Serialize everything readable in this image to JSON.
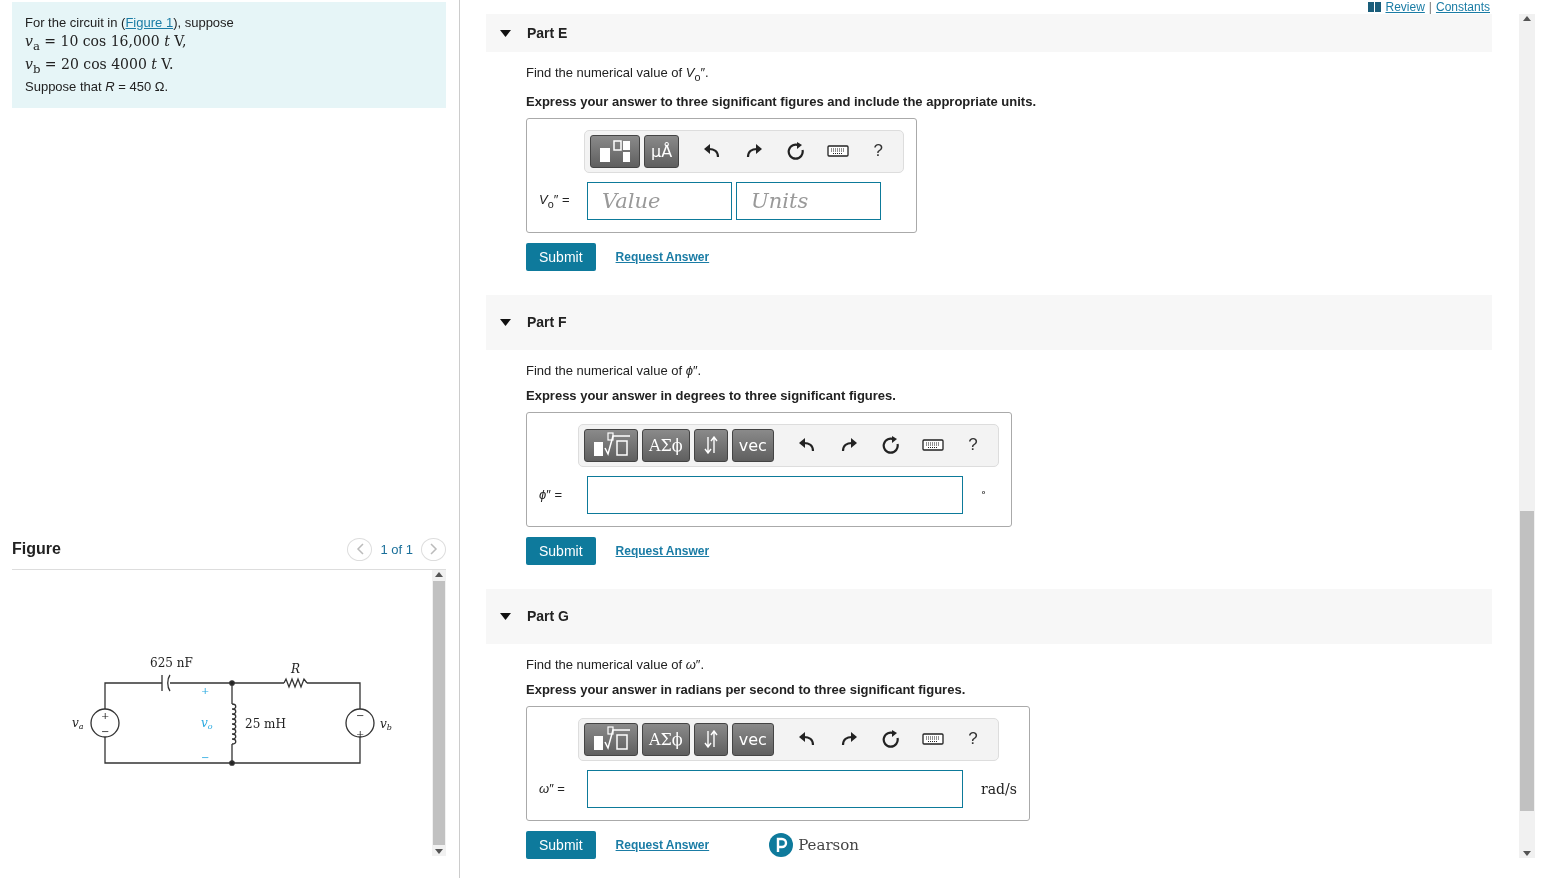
{
  "problem": {
    "intro": {
      "before": "For the circuit in (",
      "link": "Figure 1",
      "after": "), suppose"
    },
    "lines": [
      "*v*$_{a}$ = 10 cos 16,000 *t* V,",
      "*v*$_{b}$ = 20 cos 4000 *t* V."
    ],
    "closing": "Suppose that *R* = 450 Ω."
  },
  "figure": {
    "title": "Figure",
    "pager": "1 of 1",
    "capacitor": "625 nF",
    "resistor": "R",
    "inductor": "25 mH",
    "sources": [
      {
        "symbol": "v",
        "subscript": "a",
        "top": "+",
        "bottom": "−"
      },
      {
        "symbol": "v",
        "subscript": "b",
        "top": "−",
        "bottom": "+"
      }
    ],
    "output": {
      "symbol": "v",
      "subscript": "o",
      "plus": "+",
      "minus": "−"
    }
  },
  "links": {
    "review": "Review",
    "separator": "|",
    "constants": "Constants"
  },
  "parts": [
    {
      "title": "Part E",
      "expanded": true,
      "prompt": "Find the numerical value of *V*$_{o}$″.",
      "instruction": "Express your answer to three significant figures and include the appropriate units.",
      "variable": "*V*$_{o}$″ =",
      "toolbar": [
        {
          "kind": "grid"
        },
        {
          "kind": "label",
          "label": "μÅ"
        }
      ],
      "help": "?",
      "fields": [
        {
          "placeholder": "Value"
        },
        {
          "placeholder": "Units"
        }
      ],
      "submit": "Submit",
      "request": "Request Answer"
    },
    {
      "title": "Part F",
      "expanded": true,
      "prompt": "Find the numerical value of *ϕ*″.",
      "instruction": "Express your answer in degrees to three significant figures.",
      "variable": "*ϕ*″ =",
      "toolbar": [
        {
          "kind": "root"
        },
        {
          "kind": "label",
          "label": "ΑΣϕ"
        },
        {
          "kind": "arrows"
        },
        {
          "kind": "label",
          "label": "vec"
        }
      ],
      "help": "?",
      "unit": "°",
      "submit": "Submit",
      "request": "Request Answer"
    },
    {
      "title": "Part G",
      "expanded": true,
      "prompt": "Find the numerical value of *ω*″.",
      "instruction": "Express your answer in radians per second to three significant figures.",
      "variable": "*ω*″ =",
      "toolbar": [
        {
          "kind": "root"
        },
        {
          "kind": "label",
          "label": "ΑΣϕ"
        },
        {
          "kind": "arrows"
        },
        {
          "kind": "label",
          "label": "vec"
        }
      ],
      "help": "?",
      "unit": "rad/s",
      "submit": "Submit",
      "request": "Request Answer"
    }
  ],
  "footer": {
    "brand": "Pearson"
  }
}
